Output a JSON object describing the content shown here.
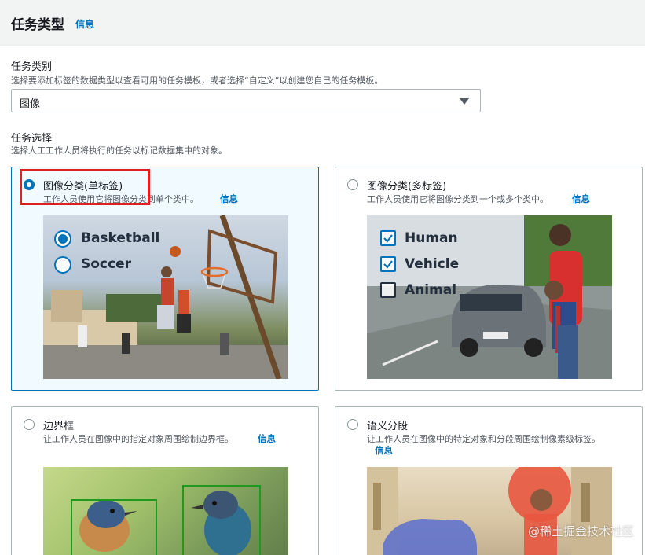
{
  "header": {
    "title": "任务类型",
    "info": "信息"
  },
  "category": {
    "label": "任务类别",
    "description": "选择要添加标签的数据类型以查看可用的任务模板，或者选择“自定义”以创建您自己的任务模板。",
    "selected": "图像"
  },
  "selection": {
    "label": "任务选择",
    "description": "选择人工工作人员将执行的任务以标记数据集中的对象。"
  },
  "cards": [
    {
      "title": "图像分类(单标签)",
      "description": "工作人员使用它将图像分类到单个类中。",
      "info": "信息",
      "selected": true,
      "options": [
        "Basketball",
        "Soccer"
      ],
      "checked_index": 0
    },
    {
      "title": "图像分类(多标签)",
      "description": "工作人员使用它将图像分类到一个或多个类中。",
      "info": "信息",
      "selected": false,
      "options": [
        "Human",
        "Vehicle",
        "Animal"
      ],
      "checked": [
        true,
        true,
        false
      ]
    },
    {
      "title": "边界框",
      "description": "让工作人员在图像中的指定对象周围绘制边界框。",
      "info": "信息",
      "selected": false
    },
    {
      "title": "语义分段",
      "description": "让工作人员在图像中的特定对象和分段周围绘制像素级标签。",
      "info": "信息",
      "selected": false
    }
  ],
  "watermark": "@稀土掘金技术社区",
  "colors": {
    "accent": "#0073bb",
    "highlight": "#e02020",
    "selected_bg": "#f1faff"
  }
}
